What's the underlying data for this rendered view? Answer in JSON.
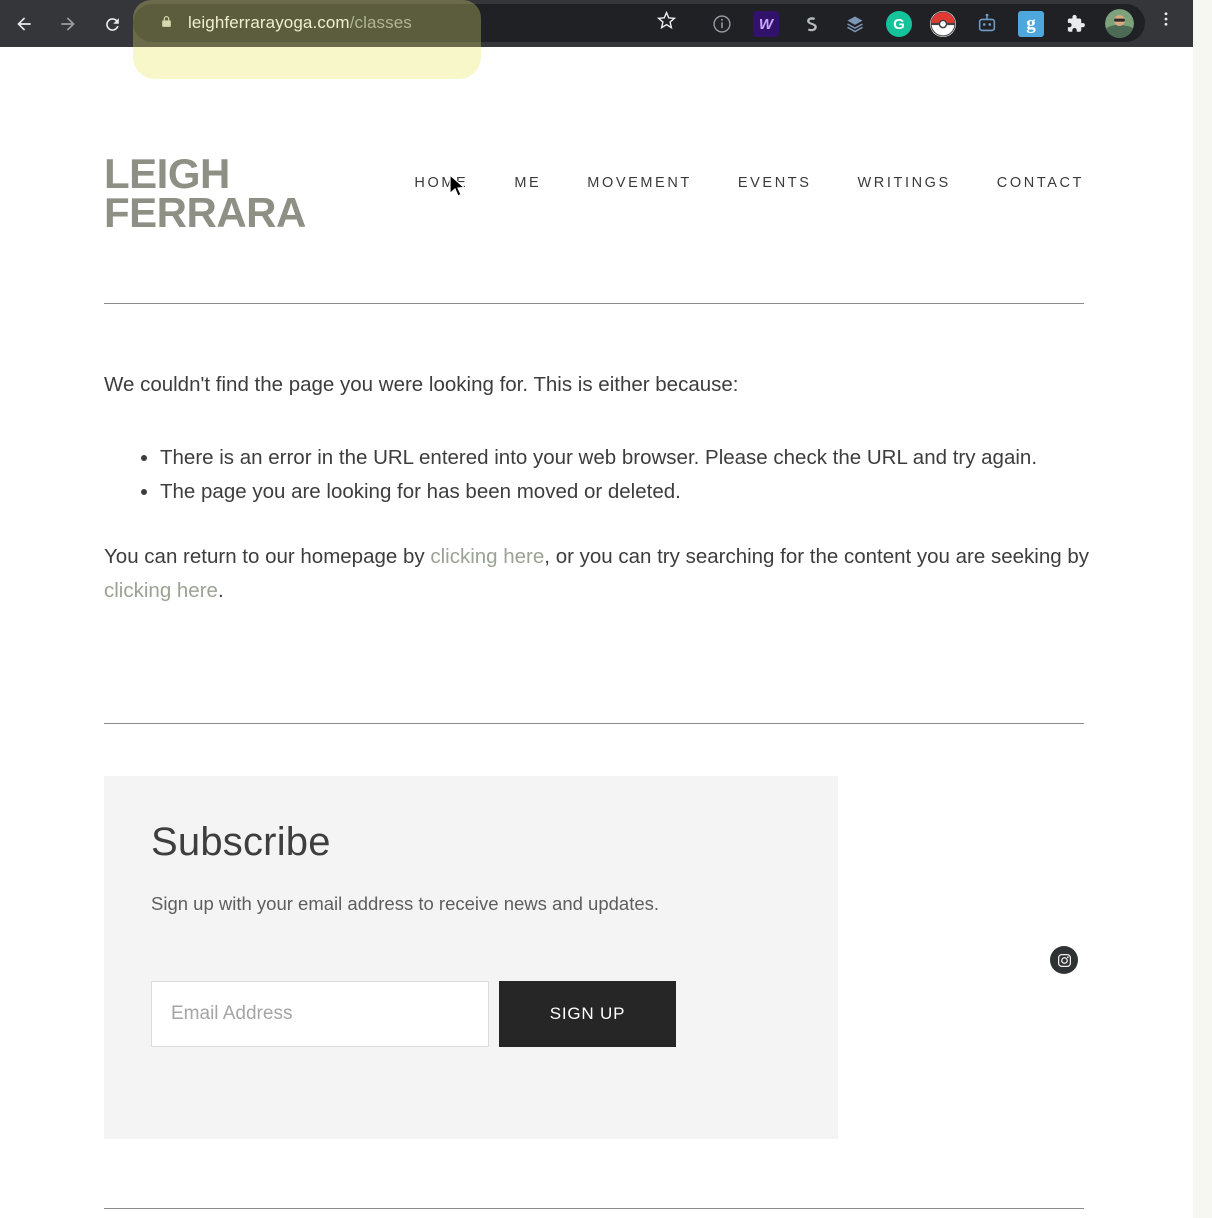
{
  "browser": {
    "back_icon": "back-arrow-icon",
    "forward_icon": "forward-arrow-icon",
    "reload_icon": "reload-icon",
    "lock_icon": "lock-icon",
    "url_domain": "leighferrarayoga.com",
    "url_path": "/classes",
    "bookmark_icon": "star-icon",
    "menu_icon": "three-dot-menu-icon",
    "chrome_bg": "#35363a",
    "omnibox_bg": "#202124",
    "highlight_color": "#f7f7c9",
    "extensions": [
      {
        "name": "info-circle-icon",
        "glyph": "ⓘ",
        "bg": "transparent",
        "color": "#9aa0a6"
      },
      {
        "name": "wallet-extension-icon",
        "glyph": "W",
        "bg": "#30126b",
        "color": "#c8a2ff"
      },
      {
        "name": "grammar-s-extension-icon",
        "glyph": "S",
        "bg": "transparent",
        "color": "#b7bcbf"
      },
      {
        "name": "layers-extension-icon",
        "glyph": "☲",
        "bg": "transparent",
        "color": "#7e96b5"
      },
      {
        "name": "grammarly-extension-icon",
        "glyph": "G",
        "bg": "#15c39a",
        "color": "#ffffff"
      },
      {
        "name": "pokeball-extension-icon",
        "glyph": "",
        "bg": "#e23b35",
        "color": "#ffffff"
      },
      {
        "name": "robot-extension-icon",
        "glyph": "⚙",
        "bg": "transparent",
        "color": "#6d9ecb"
      },
      {
        "name": "goodreads-extension-icon",
        "glyph": "g",
        "bg": "#4ea8de",
        "color": "#ffffff"
      },
      {
        "name": "extensions-puzzle-icon",
        "glyph": "❖",
        "bg": "transparent",
        "color": "#e8eaed"
      },
      {
        "name": "profile-avatar",
        "glyph": "",
        "bg": "#6b8e5a",
        "color": "#ffffff"
      }
    ]
  },
  "site": {
    "logo_text": "LEIGH\nFERRARA",
    "logo_color": "#8e9085",
    "nav": [
      {
        "label": "HOME",
        "name": "nav-link-home"
      },
      {
        "label": "ME",
        "name": "nav-link-me"
      },
      {
        "label": "MOVEMENT",
        "name": "nav-link-movement"
      },
      {
        "label": "EVENTS",
        "name": "nav-link-events"
      },
      {
        "label": "WRITINGS",
        "name": "nav-link-writings"
      },
      {
        "label": "CONTACT",
        "name": "nav-link-contact"
      }
    ]
  },
  "content": {
    "intro": "We couldn't find the page you were looking for. This is either because:",
    "reasons": [
      "There is an error in the URL entered into your web browser. Please check the URL and try again.",
      "The page you are looking for has been moved or deleted."
    ],
    "outro_part1": "You can return to our homepage by ",
    "outro_link1": "clicking here",
    "outro_part2": ", or you can try searching for the content you are seeking by ",
    "outro_link2": "clicking here",
    "outro_part3": ".",
    "link_color": "#9aa394"
  },
  "subscribe": {
    "heading": "Subscribe",
    "description": "Sign up with your email address to receive news and updates.",
    "email_placeholder": "Email Address",
    "email_value": "",
    "signup_label": "SIGN UP",
    "button_bg": "#262626",
    "panel_bg": "#f4f4f4"
  },
  "social": {
    "instagram_icon": "instagram-icon"
  }
}
